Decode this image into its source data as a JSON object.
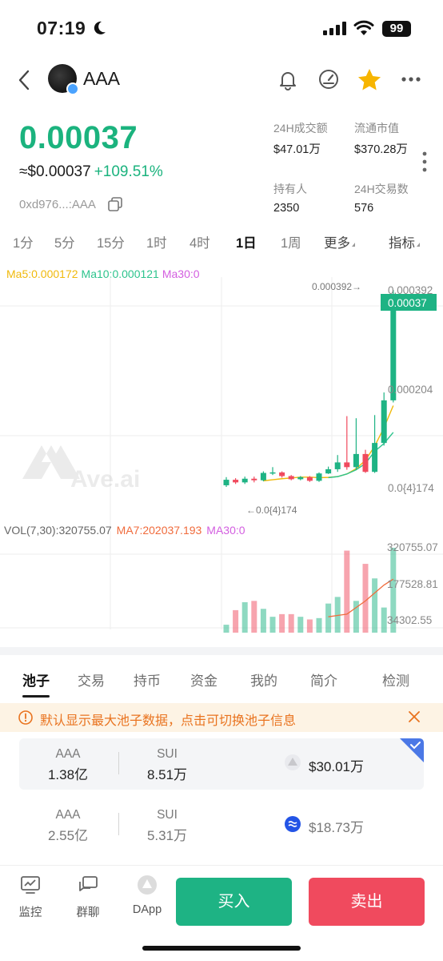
{
  "status_bar": {
    "time": "07:19",
    "battery": "99"
  },
  "header": {
    "token_name": "AAA"
  },
  "price": {
    "value": "0.00037",
    "usd_value": "≈$0.00037",
    "change": "+109.51%",
    "contract": "0xd976...:AAA"
  },
  "stats": [
    {
      "label": "24H成交额",
      "value": "$47.01万"
    },
    {
      "label": "流通市值",
      "value": "$370.28万"
    },
    {
      "label": "持有人",
      "value": "2350"
    },
    {
      "label": "24H交易数",
      "value": "576"
    }
  ],
  "intervals": [
    "1分",
    "5分",
    "15分",
    "1时",
    "4时",
    "1日",
    "1周",
    "更多",
    "指标"
  ],
  "active_interval": "1日",
  "ma": {
    "ma5": "Ma5:0.000172",
    "ma10": "Ma10:0.000121",
    "ma30": "Ma30:0"
  },
  "price_axis": {
    "top": "0.000392",
    "mid": "0.000204",
    "low": "0.0{4}174"
  },
  "current_price_tag": "0.00037",
  "high_marker": "0.000392→",
  "low_marker": "←0.0{4}174",
  "watermark": "Ave.ai",
  "volume": {
    "main": "VOL(7,30):320755.07",
    "ma7": "MA7:202037.193",
    "ma30": "MA30:0"
  },
  "volume_axis": {
    "top": "320755.07",
    "mid": "177528.81",
    "low": "34302.55"
  },
  "chart_data": {
    "type": "candlestick",
    "candles": [
      {
        "open": 2.05e-05,
        "close": 3.1e-05,
        "high": 3.6e-05,
        "low": 1.74e-05
      },
      {
        "open": 3.1e-05,
        "close": 2.6e-05,
        "high": 3.4e-05,
        "low": 2.3e-05
      },
      {
        "open": 2.6e-05,
        "close": 3.3e-05,
        "high": 3.7e-05,
        "low": 2.3e-05
      },
      {
        "open": 3.3e-05,
        "close": 3e-05,
        "high": 3.7e-05,
        "low": 2.6e-05
      },
      {
        "open": 3e-05,
        "close": 4.4e-05,
        "high": 4.7e-05,
        "low": 2.8e-05
      },
      {
        "open": 4.4e-05,
        "close": 4.5e-05,
        "high": 5.5e-05,
        "low": 4e-05
      },
      {
        "open": 4.5e-05,
        "close": 3.8e-05,
        "high": 4.7e-05,
        "low": 3.5e-05
      },
      {
        "open": 3.8e-05,
        "close": 3.2e-05,
        "high": 4e-05,
        "low": 3e-05
      },
      {
        "open": 3.2e-05,
        "close": 3.6e-05,
        "high": 3.8e-05,
        "low": 3e-05
      },
      {
        "open": 3.6e-05,
        "close": 2.9e-05,
        "high": 3.8e-05,
        "low": 2.7e-05
      },
      {
        "open": 2.9e-05,
        "close": 4.3e-05,
        "high": 4.5e-05,
        "low": 2.7e-05
      },
      {
        "open": 4.3e-05,
        "close": 5.1e-05,
        "high": 5.6e-05,
        "low": 4.2e-05
      },
      {
        "open": 5.1e-05,
        "close": 6.4e-05,
        "high": 7.8e-05,
        "low": 4.6e-05
      },
      {
        "open": 6.4e-05,
        "close": 5.5e-05,
        "high": 0.000152,
        "low": 5e-05
      },
      {
        "open": 5.5e-05,
        "close": 8e-05,
        "high": 0.000148,
        "low": 5e-05
      },
      {
        "open": 8e-05,
        "close": 4.6e-05,
        "high": 8.8e-05,
        "low": 4.4e-05
      },
      {
        "open": 4.6e-05,
        "close": 0.000101,
        "high": 0.000154,
        "low": 4.4e-05
      },
      {
        "open": 0.000101,
        "close": 0.000182,
        "high": 0.000197,
        "low": 9.6e-05
      },
      {
        "open": 0.000182,
        "close": 0.00037,
        "high": 0.000392,
        "low": 0.000178
      }
    ],
    "ma5": [
      2.9e-05,
      3.1e-05,
      3.3e-05,
      3.45e-05,
      3.6e-05,
      3.6e-05,
      3.5e-05,
      3.55e-05,
      3.7e-05,
      4.2e-05,
      5.2e-05,
      6.8e-05,
      9.5e-05,
      0.00013,
      0.000172
    ],
    "ma5_start": 4,
    "ma10": [
      3.5e-05,
      3.7e-05,
      4.2e-05,
      5e-05,
      6.2e-05,
      8.5e-05,
      0.0001,
      0.000121
    ],
    "ma10_start": 11,
    "volumes": [
      30000,
      85000,
      115000,
      120000,
      90000,
      60000,
      70000,
      70000,
      60000,
      50000,
      55000,
      110000,
      135000,
      310000,
      120000,
      260000,
      205000,
      95000,
      320755
    ],
    "vol_ma7": [
      60000,
      65000,
      70000,
      95000,
      120000,
      150000,
      180000,
      202037
    ],
    "vol_ma7_start": 11,
    "ylim": [
      1.74e-05,
      0.000392
    ],
    "vol_ylim": [
      0,
      320755.07
    ]
  },
  "bottom_tabs": [
    "池子",
    "交易",
    "持币",
    "资金",
    "我的",
    "简介",
    "检测"
  ],
  "notice": "默认显示最大池子数据，点击可切换池子信息",
  "pools": [
    {
      "token_a": "AAA",
      "amount_a": "1.38亿",
      "token_b": "SUI",
      "amount_b": "8.51万",
      "liquidity": "$30.01万"
    },
    {
      "token_a": "AAA",
      "amount_a": "2.55亿",
      "token_b": "SUI",
      "amount_b": "5.31万",
      "liquidity": "$18.73万"
    }
  ],
  "bottom_bar": {
    "monitor": "监控",
    "group_chat": "群聊",
    "dapp": "DApp",
    "buy": "买入",
    "sell": "卖出"
  },
  "colors": {
    "up": "#1eb384",
    "down": "#f04a5e",
    "ma5": "#f0b90b",
    "ma10": "#2dc48d",
    "ma30": "#d35ee0",
    "vol_ma7": "#f06b3c"
  }
}
